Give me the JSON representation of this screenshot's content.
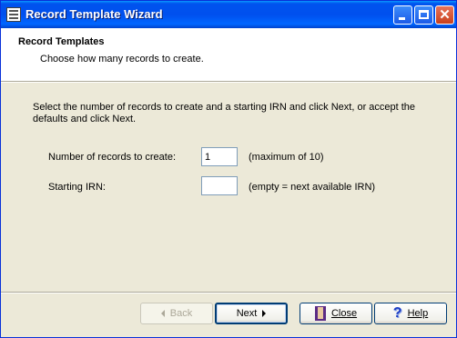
{
  "window": {
    "title": "Record Template Wizard"
  },
  "header": {
    "title": "Record Templates",
    "subtitle": "Choose how many records to create."
  },
  "body": {
    "description": "Select the number of records to create and a starting IRN and click Next, or accept the defaults and click Next.",
    "records_label": "Number of records to create:",
    "records_value": "1",
    "records_hint": "(maximum of 10)",
    "irn_label": "Starting IRN:",
    "irn_value": "",
    "irn_hint": "(empty = next available IRN)"
  },
  "buttons": {
    "back": {
      "label": "Back",
      "icon": "arrow-left-icon",
      "enabled": false
    },
    "next": {
      "label": "Next",
      "icon": "arrow-right-icon",
      "enabled": true
    },
    "close": {
      "label": "Close",
      "icon": "close-icon",
      "enabled": true
    },
    "help": {
      "label": "Help",
      "icon": "help-icon",
      "enabled": true
    }
  },
  "colors": {
    "titlebar": "#0053ee",
    "dialog_bg": "#ece9d8",
    "accent_border": "#003c74"
  }
}
